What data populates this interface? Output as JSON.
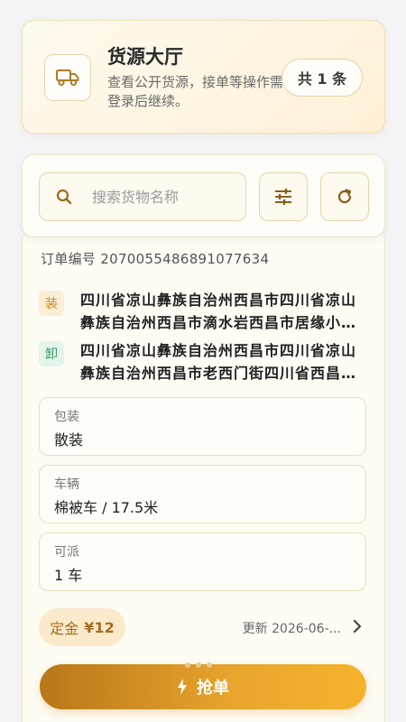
{
  "header": {
    "title": "货源大厅",
    "description": "查看公开货源，接单等操作需登录后继续。",
    "count_label": "共 1 条",
    "icon": "truck-icon"
  },
  "search": {
    "placeholder": "搜索货物名称",
    "value": "",
    "filter_icon": "sliders-icon",
    "refresh_icon": "refresh-icon"
  },
  "order": {
    "order_number": "订单编号 2070055486891077634",
    "load": {
      "tag": "装",
      "address": "四川省凉山彝族自治州西昌市四川省凉山彝族自治州西昌市滴水岩西昌市居缘小区西..."
    },
    "unload": {
      "tag": "卸",
      "address": "四川省凉山彝族自治州西昌市四川省凉山彝族自治州西昌市老西门街四川省西昌市第..."
    },
    "fields": [
      {
        "label": "包装",
        "value": "散装"
      },
      {
        "label": "车辆",
        "value": "棉被车 / 17.5米"
      },
      {
        "label": "可派",
        "value": "1 车"
      }
    ],
    "deposit_label": "定金",
    "deposit_value": "¥12",
    "updated_text": "更新 2026-06-..."
  },
  "action": {
    "grab_label": "抢单",
    "icon": "bolt-icon"
  },
  "colors": {
    "accent": "#e9a52e",
    "accent_dark": "#b87719",
    "load_tag": "#c58a2a",
    "unload_tag": "#3c9a66"
  }
}
